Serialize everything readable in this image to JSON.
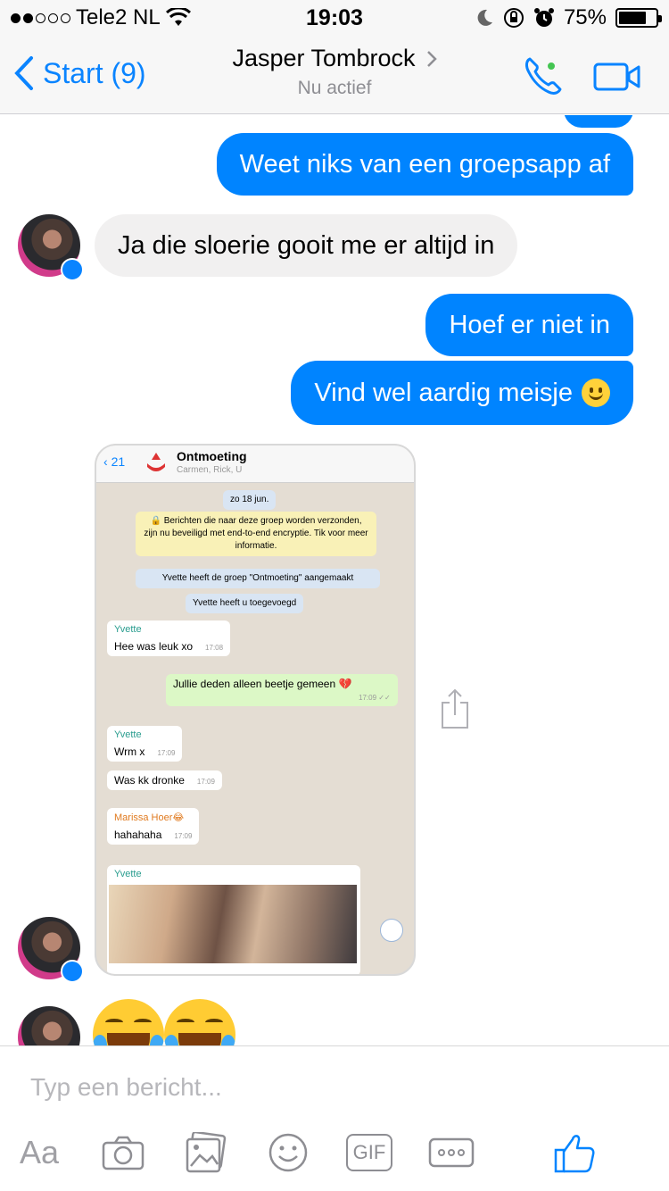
{
  "status_bar": {
    "carrier": "Tele2 NL",
    "time": "19:03",
    "battery": "75%",
    "battery_level": 0.75
  },
  "nav": {
    "back_label": "Start (9)",
    "contact_name": "Jasper Tombrock",
    "contact_status": "Nu actief",
    "online_color": "#44c552"
  },
  "messages": [
    {
      "side": "out",
      "text": "Weet niks van een groepsapp af"
    },
    {
      "side": "in",
      "text": "Ja die sloerie gooit me er altijd in"
    },
    {
      "side": "out",
      "text": "Hoef er niet in"
    },
    {
      "side": "out",
      "text": "Vind wel aardig meisje",
      "emoji": "slightly-smiling-face"
    }
  ],
  "shared_screenshot": {
    "back_count": "21",
    "group_name": "Ontmoeting",
    "members": "Carmen, Rick, U",
    "date_chip": "zo 18 jun.",
    "encryption_notice": "🔒 Berichten die naar deze groep worden verzonden, zijn nu beveiligd met end-to-end encryptie. Tik voor meer informatie.",
    "system_1": "Yvette heeft de groep \"Ontmoeting\" aangemaakt",
    "system_2": "Yvette heeft u toegevoegd",
    "chat": [
      {
        "sender": "Yvette",
        "text": "Hee was leuk xo",
        "time": "17:08"
      },
      {
        "sender": "",
        "text": "Jullie deden alleen beetje gemeen 💔",
        "time": "17:09 ✓✓"
      },
      {
        "sender": "Yvette",
        "text": "Wrm x",
        "time": "17:09"
      },
      {
        "sender": "",
        "text": "Was kk dronke",
        "time": "17:09"
      },
      {
        "sender": "Marissa Hoer😂",
        "text": "hahahaha",
        "time": "17:09"
      },
      {
        "sender": "Yvette",
        "text": "",
        "time": ""
      }
    ]
  },
  "reaction_emojis": [
    "face-with-tears-of-joy",
    "face-with-tears-of-joy"
  ],
  "composer": {
    "placeholder": "Typ een bericht...",
    "aa_label": "Aa",
    "gif_label": "GIF",
    "icons": [
      "camera-icon",
      "gallery-icon",
      "emoji-icon",
      "gif-icon",
      "more-icon",
      "like-icon"
    ]
  },
  "colors": {
    "accent": "#0084ff",
    "incoming_bubble": "#f1f0f0",
    "nav_blue": "#0a84ff"
  }
}
